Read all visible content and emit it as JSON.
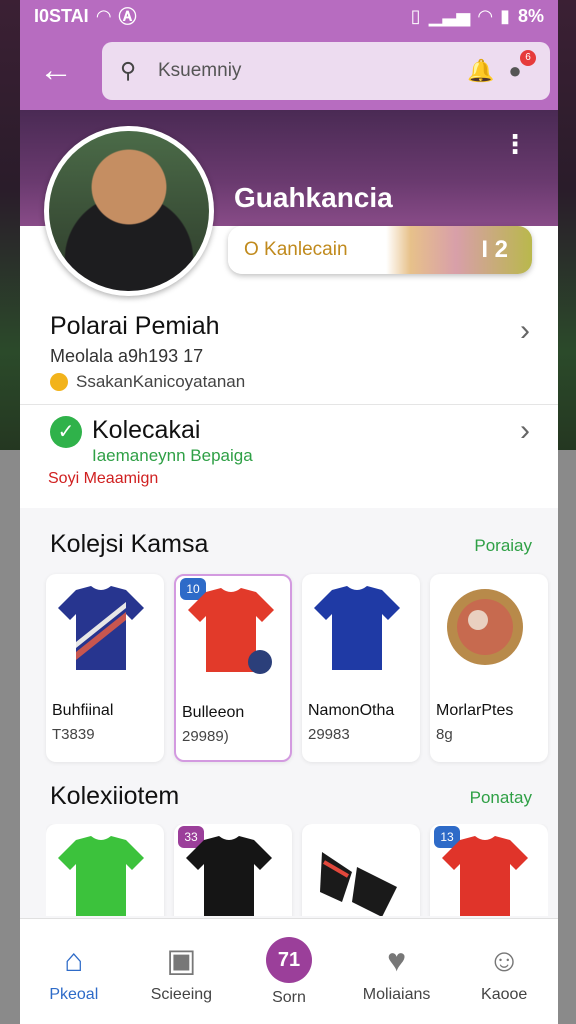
{
  "status_bar": {
    "time": "I0STAI",
    "battery": "8%"
  },
  "header": {
    "search_placeholder": "Ksuemniy"
  },
  "profile": {
    "username": "Guahkancia",
    "level_label": "O Kanlecain",
    "level_value": "I 2"
  },
  "rows": [
    {
      "title": "Polarai Pemiah",
      "sub": "Meolala a9h193 17",
      "sub2": "SsakanKanicoyatanan"
    },
    {
      "title": "Kolecakai",
      "sub": "Iaemaneynn Bepaiga",
      "warn": "Soyi Meaamign"
    }
  ],
  "sections": [
    {
      "title": "Kolejsi Kamsa",
      "link": "Poraiay",
      "items": [
        {
          "name": "Buhfiinal",
          "meta": "T3839",
          "tag": ""
        },
        {
          "name": "Bulleeon",
          "meta": "29989)",
          "tag": "10"
        },
        {
          "name": "NamonOtha",
          "meta": "29983",
          "tag": ""
        },
        {
          "name": "MorlarPtes",
          "meta": "8g",
          "tag": ""
        }
      ]
    },
    {
      "title": "Kolexiiotem",
      "link": "Ponatay",
      "items": [
        {
          "name": "",
          "meta": "",
          "tag": ""
        },
        {
          "name": "",
          "meta": "",
          "tag": "33"
        },
        {
          "name": "",
          "meta": "",
          "tag": ""
        },
        {
          "name": "",
          "meta": "",
          "tag": "13"
        }
      ]
    }
  ],
  "bottom_nav": [
    {
      "label": "Pkeoal",
      "icon": "home-icon"
    },
    {
      "label": "Scieeing",
      "icon": "image-icon"
    },
    {
      "label": "Sorn",
      "icon": "center-icon",
      "icon_text": "71"
    },
    {
      "label": "Moliaians",
      "icon": "heart-icon"
    },
    {
      "label": "Kaooe",
      "icon": "profile-icon"
    }
  ],
  "colors": {
    "accent": "#b76cc0",
    "green": "#2fa046",
    "nav_active": "#2e6bc8"
  }
}
